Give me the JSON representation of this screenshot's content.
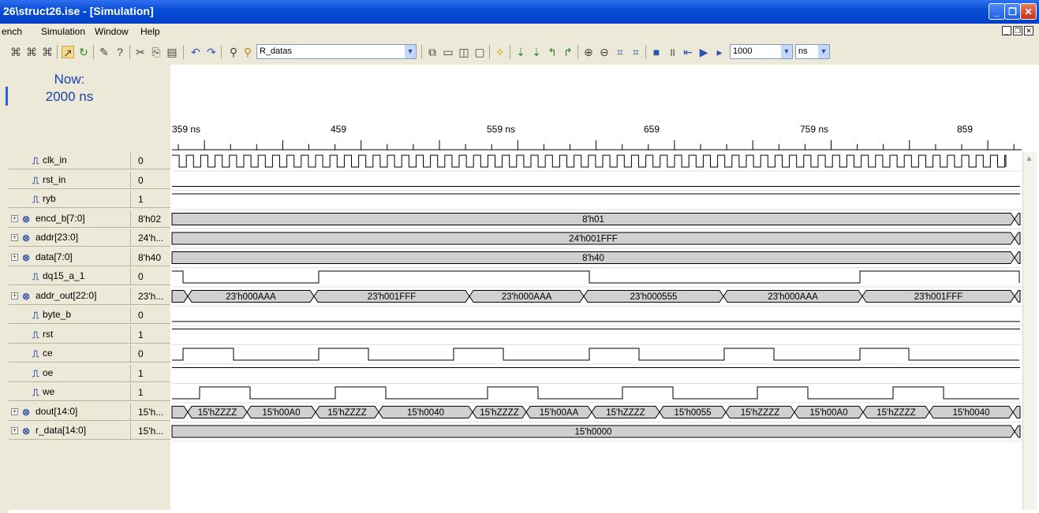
{
  "window": {
    "title": "26\\struct26.ise - [Simulation]"
  },
  "menu": [
    "ench",
    "Simulation",
    "Window",
    "Help"
  ],
  "toolbar": {
    "search_text": "R_datas",
    "sim_time": "1000",
    "time_unit": "ns"
  },
  "now": {
    "label": "Now:",
    "value": "2000 ns"
  },
  "timescale": {
    "ticks": [
      "359 ns",
      "459",
      "559 ns",
      "659",
      "759 ns",
      "859"
    ]
  },
  "colors": {
    "bus_fill": "#d0d0d0",
    "selection_blue": "#1a3fa8",
    "titlebar": "#0a4fd8",
    "panel_bg": "#ece9d8"
  },
  "signals": [
    {
      "name": "clk_in",
      "value": "0",
      "kind": "bit",
      "icon": "bit-signal-icon"
    },
    {
      "name": "rst_in",
      "value": "0",
      "kind": "bit",
      "icon": "bit-signal-icon"
    },
    {
      "name": "ryb",
      "value": "1",
      "kind": "bit",
      "icon": "bit-signal-icon"
    },
    {
      "name": "encd_b[7:0]",
      "value": "8'h02",
      "kind": "bus",
      "icon": "bus-signal-icon",
      "segments": [
        {
          "label": "8'h01"
        }
      ]
    },
    {
      "name": "addr[23:0]",
      "value": "24'h...",
      "kind": "bus",
      "icon": "bus-signal-icon",
      "segments": [
        {
          "label": "24'h001FFF"
        }
      ]
    },
    {
      "name": "data[7:0]",
      "value": "8'h40",
      "kind": "bus",
      "icon": "bus-signal-icon",
      "segments": [
        {
          "label": "8'h40"
        }
      ]
    },
    {
      "name": "dq15_a_1",
      "value": "0",
      "kind": "bit",
      "icon": "bit-signal-icon"
    },
    {
      "name": "addr_out[22:0]",
      "value": "23'h...",
      "kind": "bus",
      "icon": "bus-signal-icon",
      "segments": [
        {
          "label": "23'h000AAA"
        },
        {
          "label": "23'h001FFF"
        },
        {
          "label": "23'h000AAA"
        },
        {
          "label": "23'h000555"
        },
        {
          "label": "23'h000AAA"
        },
        {
          "label": "23'h001FFF"
        }
      ]
    },
    {
      "name": "byte_b",
      "value": "0",
      "kind": "bit",
      "icon": "bit-signal-icon"
    },
    {
      "name": "rst",
      "value": "1",
      "kind": "bit",
      "icon": "bit-signal-icon"
    },
    {
      "name": "ce",
      "value": "0",
      "kind": "bit",
      "icon": "bit-signal-icon"
    },
    {
      "name": "oe",
      "value": "1",
      "kind": "bit",
      "icon": "bit-signal-icon"
    },
    {
      "name": "we",
      "value": "1",
      "kind": "bit",
      "icon": "bit-signal-icon"
    },
    {
      "name": "dout[14:0]",
      "value": "15'h...",
      "kind": "bus",
      "icon": "bus-signal-icon",
      "segments": [
        {
          "label": "15'hZZZZ"
        },
        {
          "label": "15'h00A0"
        },
        {
          "label": "15'hZZZZ"
        },
        {
          "label": "15'h0040"
        },
        {
          "label": "15'hZZZZ"
        },
        {
          "label": "15'h00AA"
        },
        {
          "label": "15'hZZZZ"
        },
        {
          "label": "15'h0055"
        },
        {
          "label": "15'hZZZZ"
        },
        {
          "label": "15'h00A0"
        },
        {
          "label": "15'hZZZZ"
        },
        {
          "label": "15'h0040"
        }
      ]
    },
    {
      "name": "r_data[14:0]",
      "value": "15'h...",
      "kind": "bus",
      "icon": "bus-signal-icon",
      "segments": [
        {
          "label": "15'h0000"
        }
      ]
    }
  ]
}
